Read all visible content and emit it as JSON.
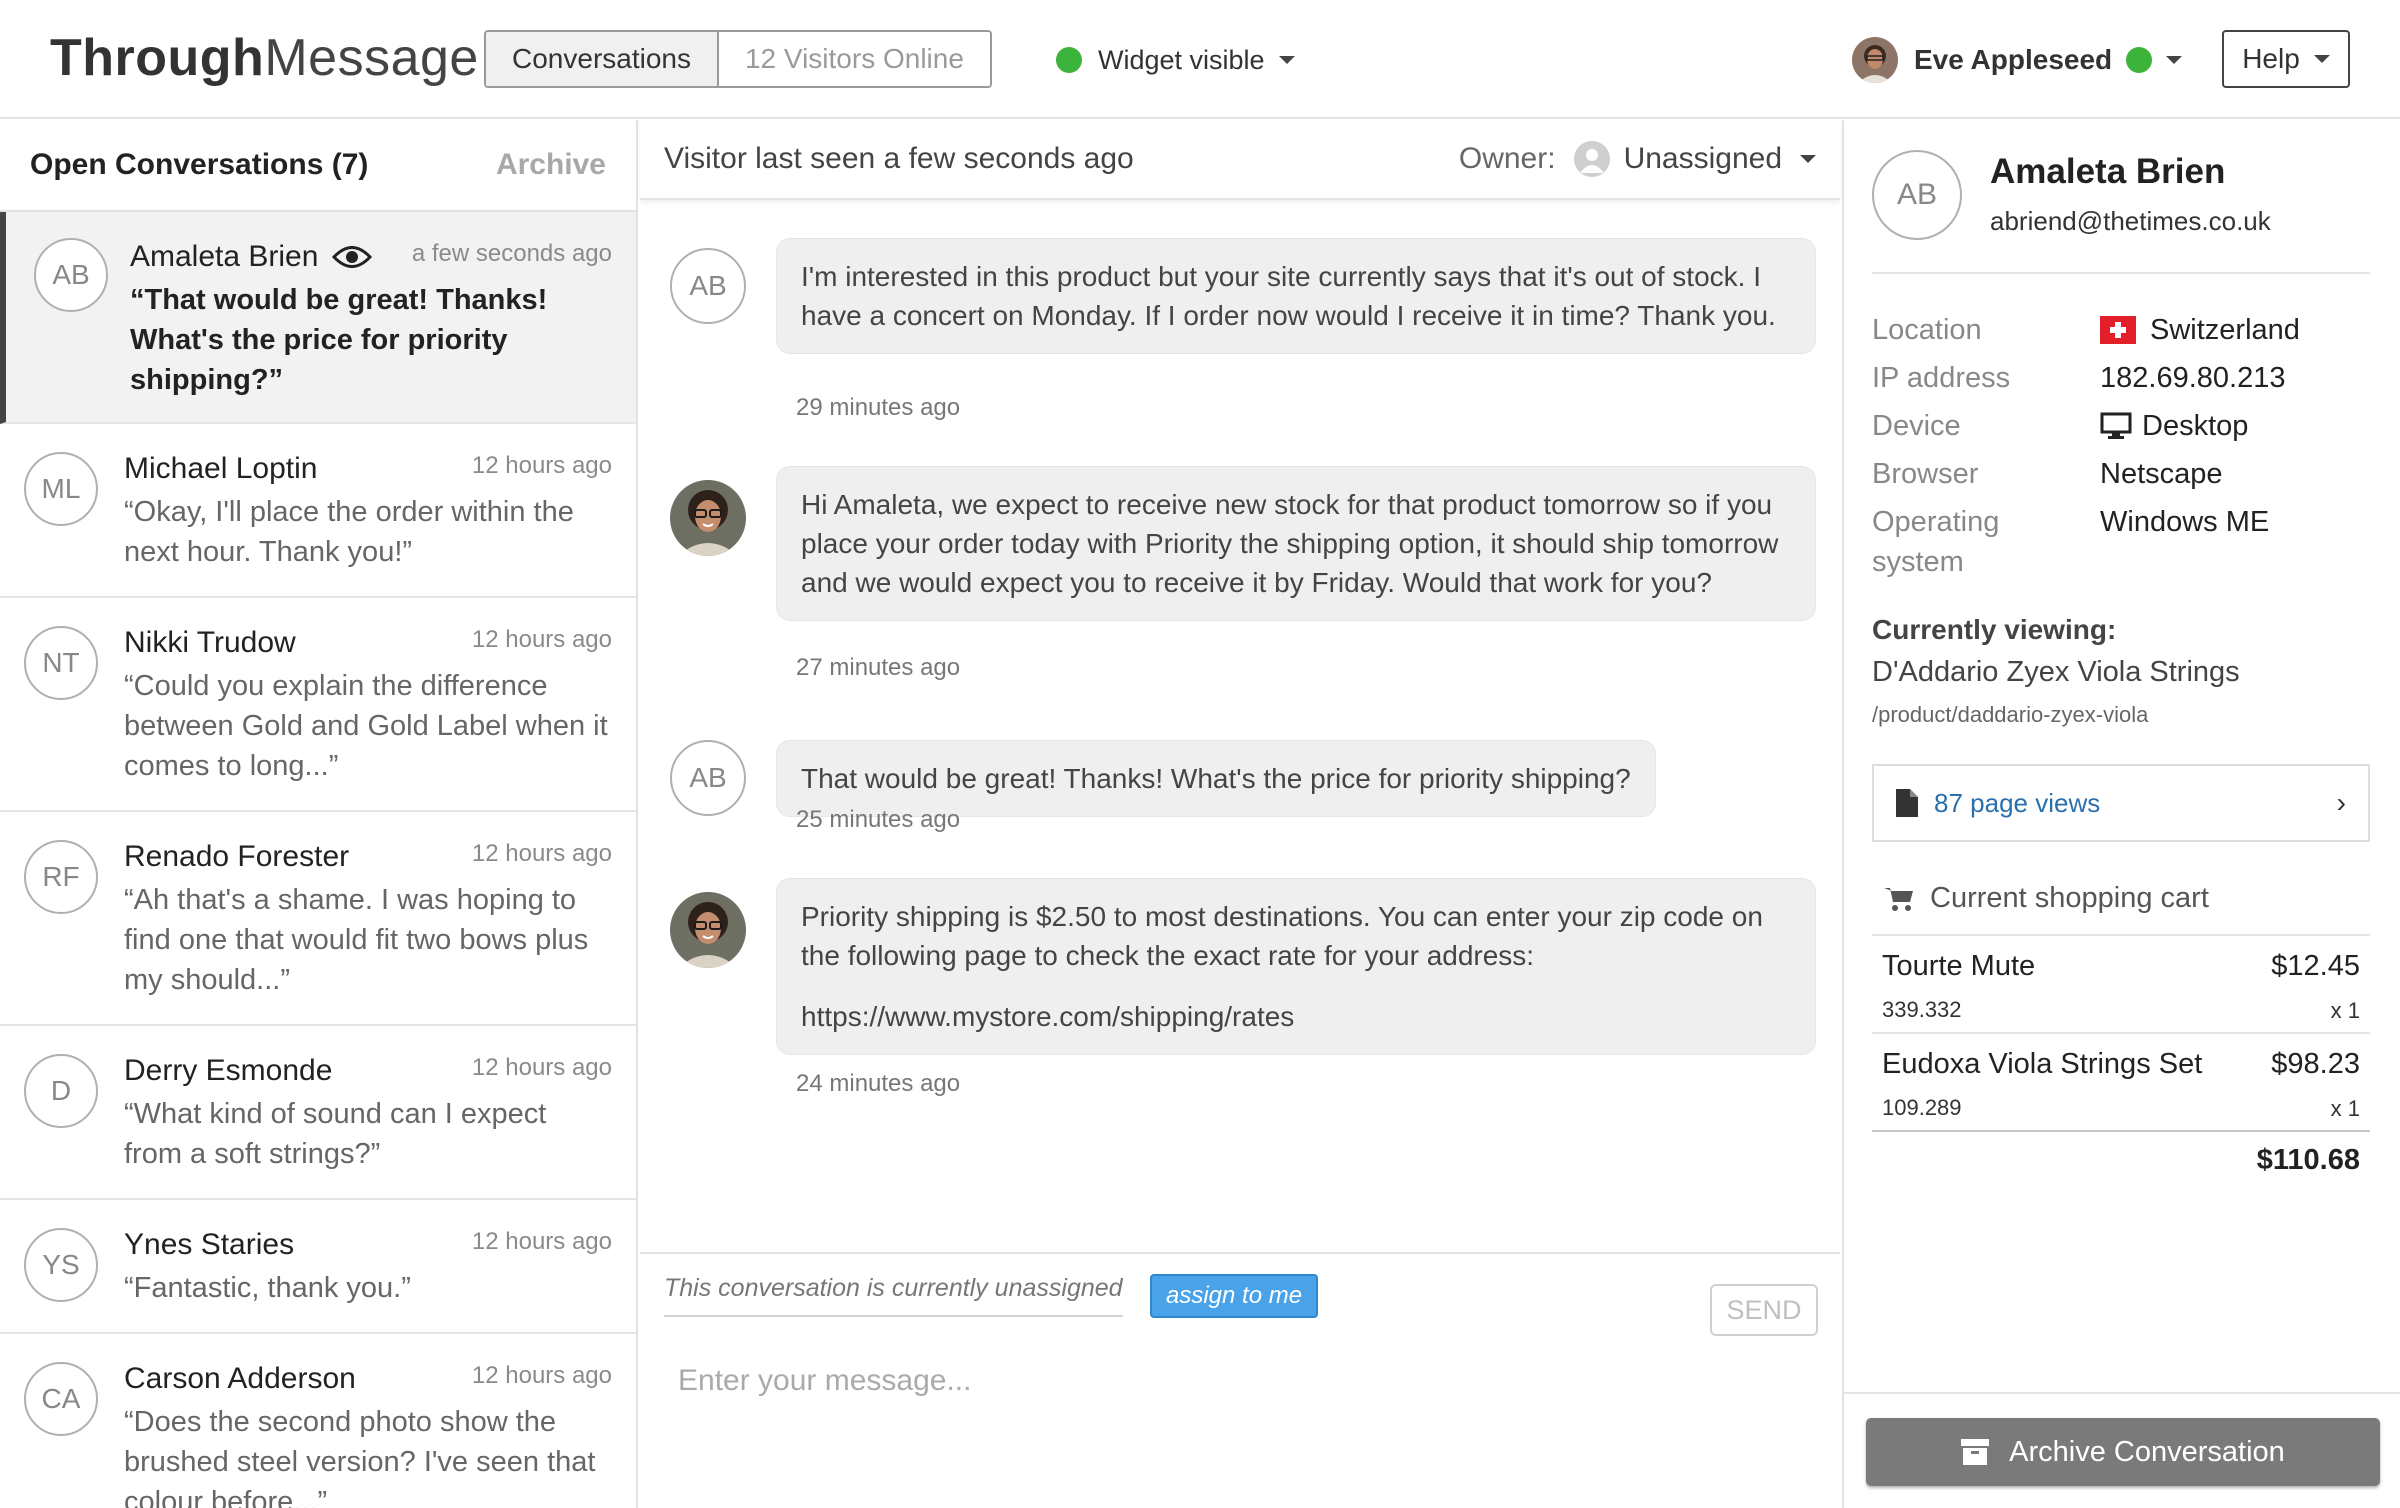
{
  "app": {
    "logo_bold": "Through",
    "logo_light": "Message"
  },
  "topbar": {
    "tabs": [
      {
        "label": "Conversations",
        "active": true
      },
      {
        "label": "12 Visitors Online",
        "active": false
      }
    ],
    "widget_status": "Widget visible",
    "user_name": "Eve Appleseed",
    "help_label": "Help",
    "status_color": "#3cb43c"
  },
  "sidebar": {
    "title": "Open Conversations (7)",
    "archive_label": "Archive",
    "conversations": [
      {
        "initials": "AB",
        "name": "Amaleta Brien",
        "time": "a few seconds ago",
        "message": "“That would be great! Thanks! What's the price for priority shipping?”",
        "active": true
      },
      {
        "initials": "ML",
        "name": "Michael Loptin",
        "time": "12 hours ago",
        "message": "“Okay, I'll place the order within the next hour. Thank you!”"
      },
      {
        "initials": "NT",
        "name": "Nikki Trudow",
        "time": "12 hours ago",
        "message": "“Could you explain the difference between Gold and Gold Label when it comes to long...”"
      },
      {
        "initials": "RF",
        "name": "Renado Forester",
        "time": "12 hours ago",
        "message": "“Ah that's a shame. I was hoping to find one that would fit two bows plus my should...”"
      },
      {
        "initials": "D",
        "name": "Derry Esmonde",
        "time": "12 hours ago",
        "message": "“What kind of sound can I expect from a soft strings?”"
      },
      {
        "initials": "YS",
        "name": "Ynes Staries",
        "time": "12 hours ago",
        "message": "“Fantastic, thank you.”"
      },
      {
        "initials": "CA",
        "name": "Carson Adderson",
        "time": "12 hours ago",
        "message": "“Does the second photo show the brushed steel version? I've seen that colour before...”"
      }
    ]
  },
  "chat": {
    "last_seen": "Visitor last seen a few seconds ago",
    "owner_label": "Owner:",
    "owner_value": "Unassigned",
    "messages": [
      {
        "from": "visitor",
        "initials": "AB",
        "text": "I'm interested in this product but your site currently says that it's out of stock. I have a concert on Monday. If I order now would I receive it in time? Thank you.",
        "time": "29 minutes ago"
      },
      {
        "from": "agent",
        "text": "Hi Amaleta, we expect to receive new stock for that product tomorrow so if you place your order today with Priority the shipping option, it should ship tomorrow and we would expect you to receive it by Friday. Would that work for you?",
        "time": "27 minutes ago"
      },
      {
        "from": "visitor",
        "initials": "AB",
        "text": "That would be great! Thanks! What's the price for priority shipping?",
        "time": "25 minutes ago"
      },
      {
        "from": "agent",
        "text": "Priority shipping is $2.50 to most destinations. You can enter your zip code on the following page to check the exact rate for your address:",
        "link": "https://www.mystore.com/shipping/rates",
        "time": "24 minutes ago"
      }
    ],
    "unassigned_note": "This conversation is currently unassigned",
    "assign_label": "assign to me",
    "send_label": "SEND",
    "input_placeholder": "Enter your message..."
  },
  "profile": {
    "initials": "AB",
    "name": "Amaleta Brien",
    "email": "abriend@thetimes.co.uk",
    "details": {
      "location_label": "Location",
      "location": "Switzerland",
      "ip_label": "IP address",
      "ip": "182.69.80.213",
      "device_label": "Device",
      "device": "Desktop",
      "browser_label": "Browser",
      "browser": "Netscape",
      "os_label": "Operating system",
      "os": "Windows ME"
    },
    "viewing_heading": "Currently viewing:",
    "viewing_title": "D'Addario Zyex Viola Strings",
    "viewing_url": "/product/daddario-zyex-viola",
    "page_views": "87 page views",
    "cart_heading": "Current shopping cart",
    "cart": [
      {
        "name": "Tourte Mute",
        "price": "$12.45",
        "sku": "339.332",
        "qty": "x 1"
      },
      {
        "name": "Eudoxa Viola Strings Set",
        "price": "$98.23",
        "sku": "109.289",
        "qty": "x 1"
      }
    ],
    "cart_total": "$110.68",
    "archive_button": "Archive Conversation"
  }
}
